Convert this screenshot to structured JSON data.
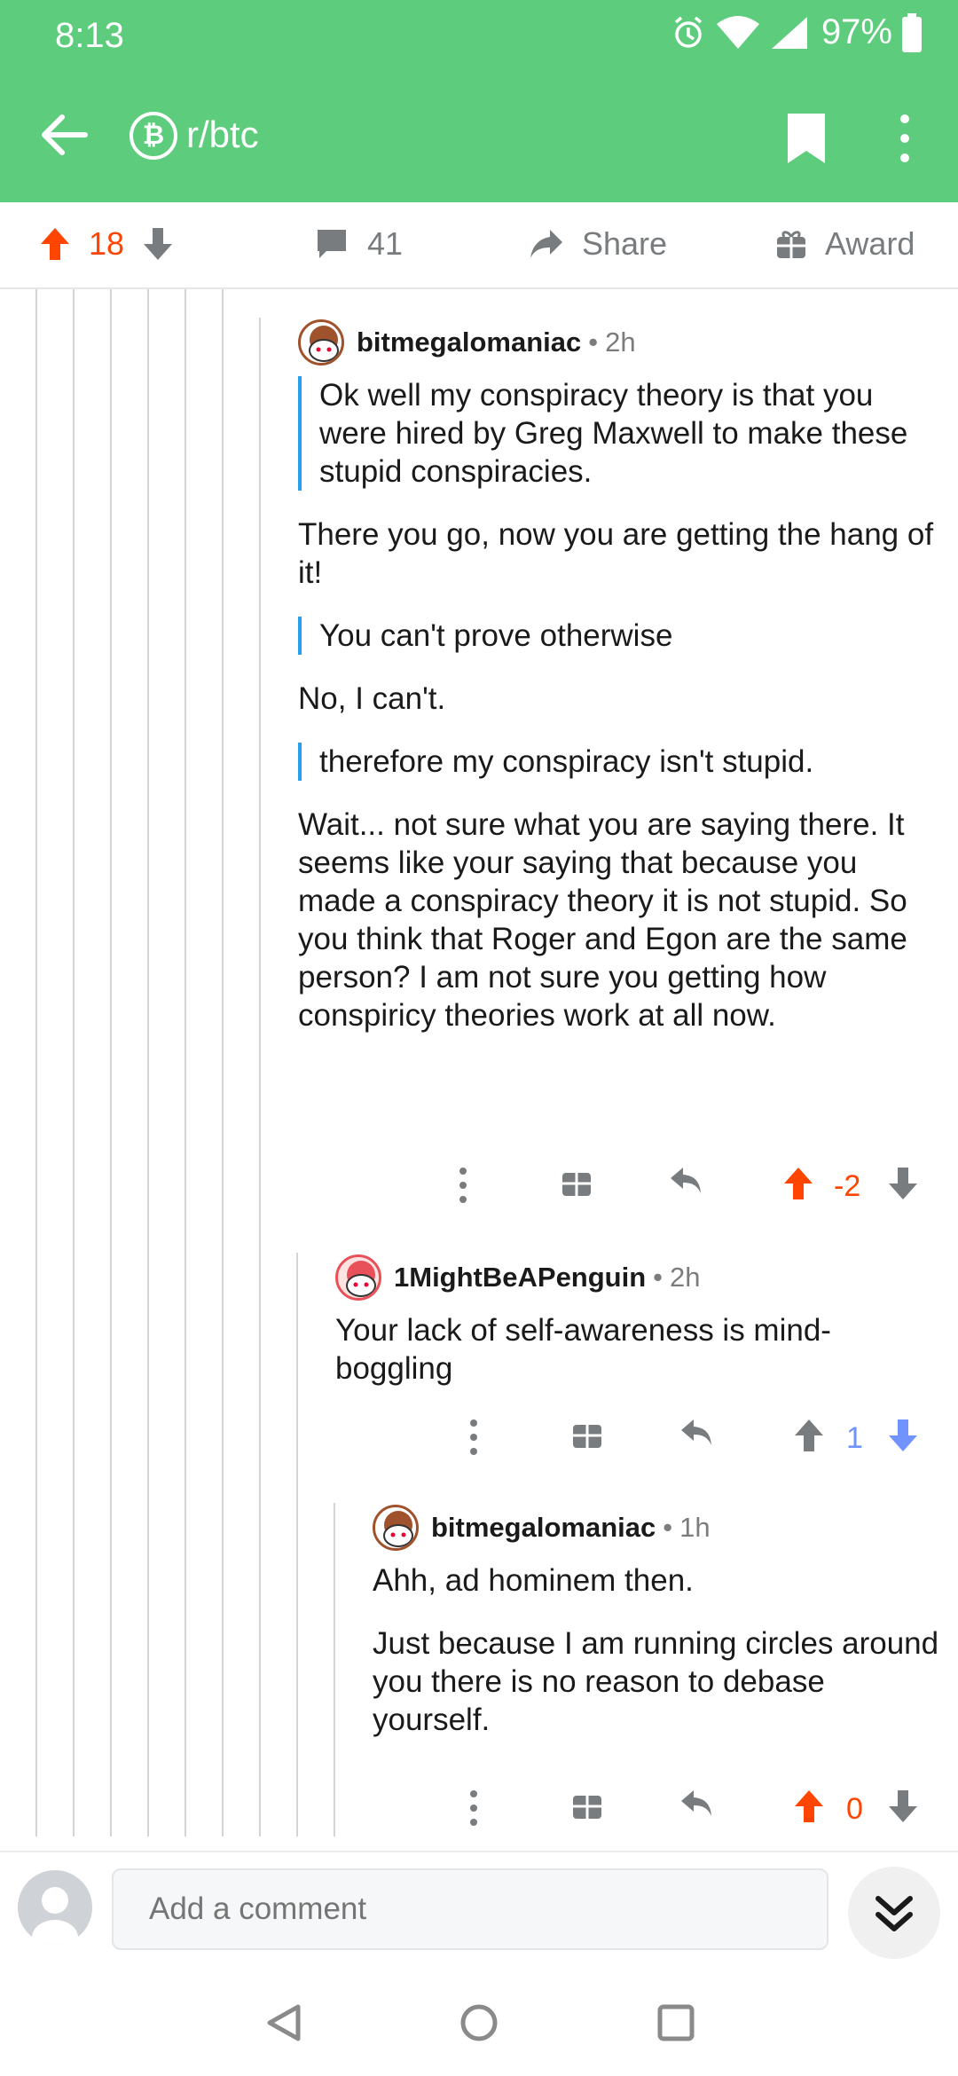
{
  "status_bar": {
    "time": "8:13",
    "battery": "97%"
  },
  "header": {
    "subreddit": "r/btc",
    "sub_icon": "bitcoin-icon"
  },
  "post_actions": {
    "score": "18",
    "comments": "41",
    "share_label": "Share",
    "award_label": "Award"
  },
  "comments": [
    {
      "author": "bitmegalomaniac",
      "time": "2h",
      "blocks": [
        {
          "type": "quote",
          "text": "Ok well my conspiracy theory is that you were hired by Greg Maxwell to make these stupid conspiracies."
        },
        {
          "type": "para",
          "text": "There you go, now you are getting the hang of it!"
        },
        {
          "type": "quote",
          "text": "You can't prove otherwise"
        },
        {
          "type": "para",
          "text": "No, I can't."
        },
        {
          "type": "quote",
          "text": "therefore my conspiracy isn't stupid."
        },
        {
          "type": "para",
          "text": "Wait... not sure what you are saying there. It seems like your saying that because you made a conspiracy theory it is not stupid. So you think that Roger and Egon are the same person?  I am not sure you getting how conspiricy theories work at all now."
        }
      ],
      "score": "-2",
      "vote_state": "up"
    },
    {
      "author": "1MightBeAPenguin",
      "time": "2h",
      "blocks": [
        {
          "type": "para",
          "text": "Your lack of self-awareness is mind-boggling"
        }
      ],
      "score": "1",
      "vote_state": "down"
    },
    {
      "author": "bitmegalomaniac",
      "time": "1h",
      "blocks": [
        {
          "type": "para",
          "text": "Ahh, ad hominem then."
        },
        {
          "type": "para",
          "text": "Just because I am running circles around you there is no reason to debase yourself."
        }
      ],
      "score": "0",
      "vote_state": "up"
    }
  ],
  "composer": {
    "placeholder": "Add a comment"
  },
  "colors": {
    "header_green": "#5dcc7c",
    "upvote": "#ff4500",
    "downvote": "#7193ff",
    "quote_bar": "#24a0ed"
  }
}
